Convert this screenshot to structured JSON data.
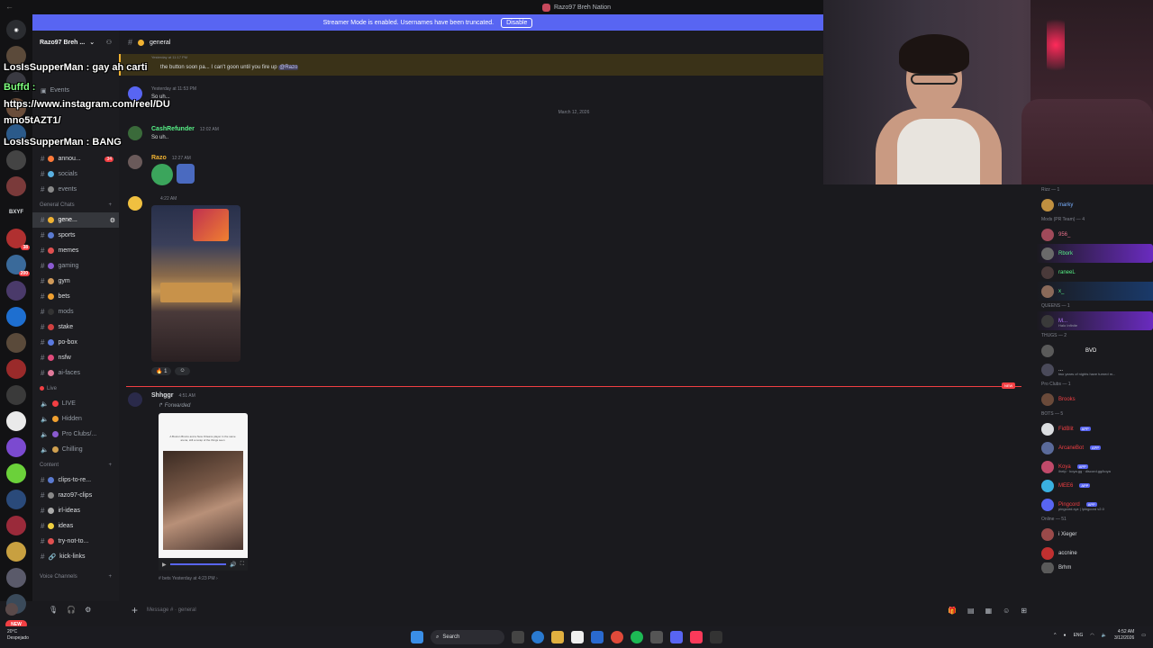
{
  "window": {
    "title": "Razo97 Breh Nation"
  },
  "banner": {
    "text": "Streamer Mode is enabled. Usernames have been truncated.",
    "button": "Disable"
  },
  "server": {
    "name": "Razo97 Breh ..."
  },
  "channel_header": {
    "name": "general"
  },
  "sidebar": {
    "events_label": "Events",
    "top_channels": [
      {
        "label": "annou...",
        "badge": "34"
      },
      {
        "label": "socials"
      },
      {
        "label": "events"
      }
    ],
    "categories": {
      "general_chats": "General Chats",
      "live": "Live",
      "content": "Content",
      "voice": "Voice Channels"
    },
    "general_channels": [
      "gene...",
      "sports",
      "memes",
      "gaming",
      "gym",
      "bets",
      "mods",
      "stake",
      "po-box",
      "nsfw",
      "ai-faces"
    ],
    "live_channels": [
      "LIVE",
      "Hidden",
      "Pro Clubs/...",
      "Chilling"
    ],
    "content_channels": [
      "clips-to-re...",
      "razo97-clips",
      "irl-ideas",
      "ideas",
      "try-not-to...",
      "kick-links"
    ]
  },
  "rail": {
    "label_bxyf": "BXYF",
    "badge_1": "38",
    "badge_2": "200",
    "badge_new": "NEW"
  },
  "messages": {
    "reply_text": "the button soon pa... I can't goon until you fire up",
    "reply_mention": "@Razo",
    "reply_ts": "Yesterday at 11:17 PM",
    "msg1_ts": "Yesterday at 11:53 PM",
    "msg1_text": "So uh...",
    "date_separator": "March 12, 2026",
    "msg2_user": "CashRefunder",
    "msg2_ts": "12:02 AM",
    "msg2_text": "So uh..",
    "msg3_user": "Razo",
    "msg3_ts": "12:27 AM",
    "msg4_ts": "4:22 AM",
    "reaction_count": "1",
    "new_tag": "NEW",
    "msg5_user": "Shhggr",
    "msg5_ts": "4:51 AM",
    "forwarded_label": "Forwarded",
    "forward_caption": "A Boston Bruins and a New Orleans player in the same arena, still a recap of the things seen",
    "forward_source": "bets",
    "forward_source_ts": "Yesterday at 4:23 PM"
  },
  "composer": {
    "placeholder": "Message # · general"
  },
  "members": {
    "groups": {
      "g1": "Rizz — 1",
      "g2": "Mods (PR Team) — 4",
      "g3": "QUEENS — 1",
      "g4": "THUGS — 2",
      "g5": "Pro Clubs — 1",
      "g6": "BOTS — 5",
      "g7": "Online — 51"
    },
    "list": [
      {
        "name": "marky",
        "color": "#7ab1ff"
      },
      {
        "name": "956_",
        "color": "#e7718a"
      },
      {
        "name": "Rbork",
        "color": "#57f287"
      },
      {
        "name": "raneeL",
        "color": "#57f287"
      },
      {
        "name": "x_",
        "color": "#57f287"
      },
      {
        "name": "M...",
        "color": "#b57bff",
        "sub": "Halo Infinite"
      },
      {
        "name": "BVD",
        "color": "#ffffff"
      },
      {
        "name": "...",
        "color": "#ffffff",
        "sub": "two years of nights have turned m..."
      },
      {
        "name": "Brooks",
        "color": "#f23f43"
      },
      {
        "name": "FidBlit",
        "color": "#f23f43",
        "app": "APP"
      },
      {
        "name": "ArcaneBot",
        "color": "#f23f43",
        "app": "APP"
      },
      {
        "name": "Koya",
        "color": "#f23f43",
        "app": "APP",
        "sub": "/help · koya.gg · discord.gg/koya"
      },
      {
        "name": "MEE6",
        "color": "#f23f43",
        "app": "APP"
      },
      {
        "name": "Pingcord",
        "color": "#f23f43",
        "app": "APP",
        "sub": "pingcord.xyz | !pingcord v2.0"
      },
      {
        "name": "i Xieger",
        "color": "#dbdee1"
      },
      {
        "name": "accnine",
        "color": "#dbdee1"
      },
      {
        "name": "Brhm",
        "color": "#dbdee1"
      }
    ]
  },
  "overlay": {
    "lines": [
      "LosIsSupperMan : gay ah carti",
      "Buffd :",
      "https://www.instagram.com/reel/DU",
      "mno5tAZT1/",
      "LosIsSupperMan : BANG"
    ]
  },
  "taskbar": {
    "weather_temp": "20°C",
    "weather_desc": "Despejado",
    "search": "Search",
    "lang": "ENG",
    "time": "4:52 AM",
    "date": "3/12/2026"
  },
  "colors": {
    "accent": "#5865f2",
    "danger": "#f23f43",
    "online": "#57f287"
  }
}
